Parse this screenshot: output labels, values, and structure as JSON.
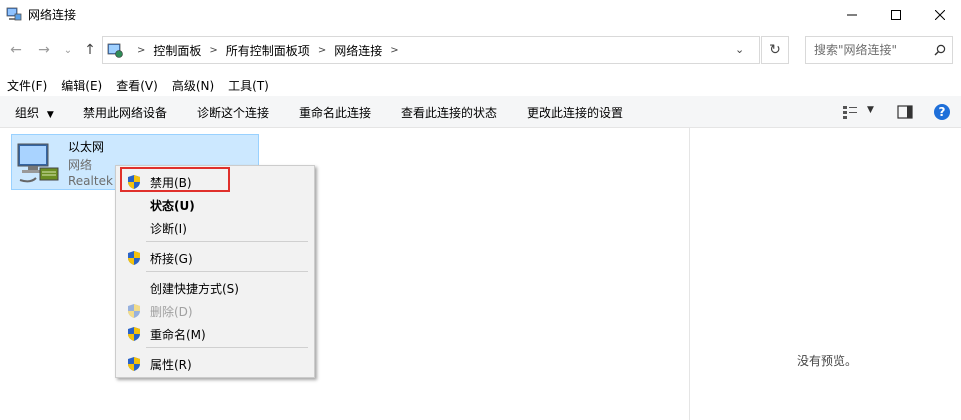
{
  "window": {
    "title": "网络连接",
    "minimize_icon": "minimize-icon",
    "maximize_icon": "maximize-icon",
    "close_icon": "close-icon"
  },
  "address_bar": {
    "breadcrumbs": [
      "控制面板",
      "所有控制面板项",
      "网络连接"
    ],
    "search_placeholder": "搜索\"网络连接\""
  },
  "menubar": {
    "items": [
      "文件(F)",
      "编辑(E)",
      "查看(V)",
      "高级(N)",
      "工具(T)"
    ]
  },
  "commandbar": {
    "organize": "组织",
    "disable": "禁用此网络设备",
    "diagnose": "诊断这个连接",
    "rename": "重命名此连接",
    "status": "查看此连接的状态",
    "settings": "更改此连接的设置"
  },
  "network_item": {
    "name": "以太网",
    "network": "网络",
    "device": "Realtek"
  },
  "context_menu": {
    "items": [
      {
        "label": "禁用(B)",
        "icon": "shield-icon",
        "highlighted": true
      },
      {
        "label": "状态(U)",
        "bold": true
      },
      {
        "label": "诊断(I)"
      },
      {
        "label": "桥接(G)",
        "icon": "shield-icon"
      },
      {
        "label": "创建快捷方式(S)"
      },
      {
        "label": "删除(D)",
        "icon": "shield-icon",
        "disabled": true
      },
      {
        "label": "重命名(M)",
        "icon": "shield-icon"
      },
      {
        "label": "属性(R)",
        "icon": "shield-icon"
      }
    ]
  },
  "preview_pane": {
    "text": "没有预览。"
  },
  "colors": {
    "selection_bg": "#cce8ff",
    "selection_border": "#99d1ff",
    "highlight_red": "#e0302b",
    "help_blue": "#1e6fd9"
  }
}
